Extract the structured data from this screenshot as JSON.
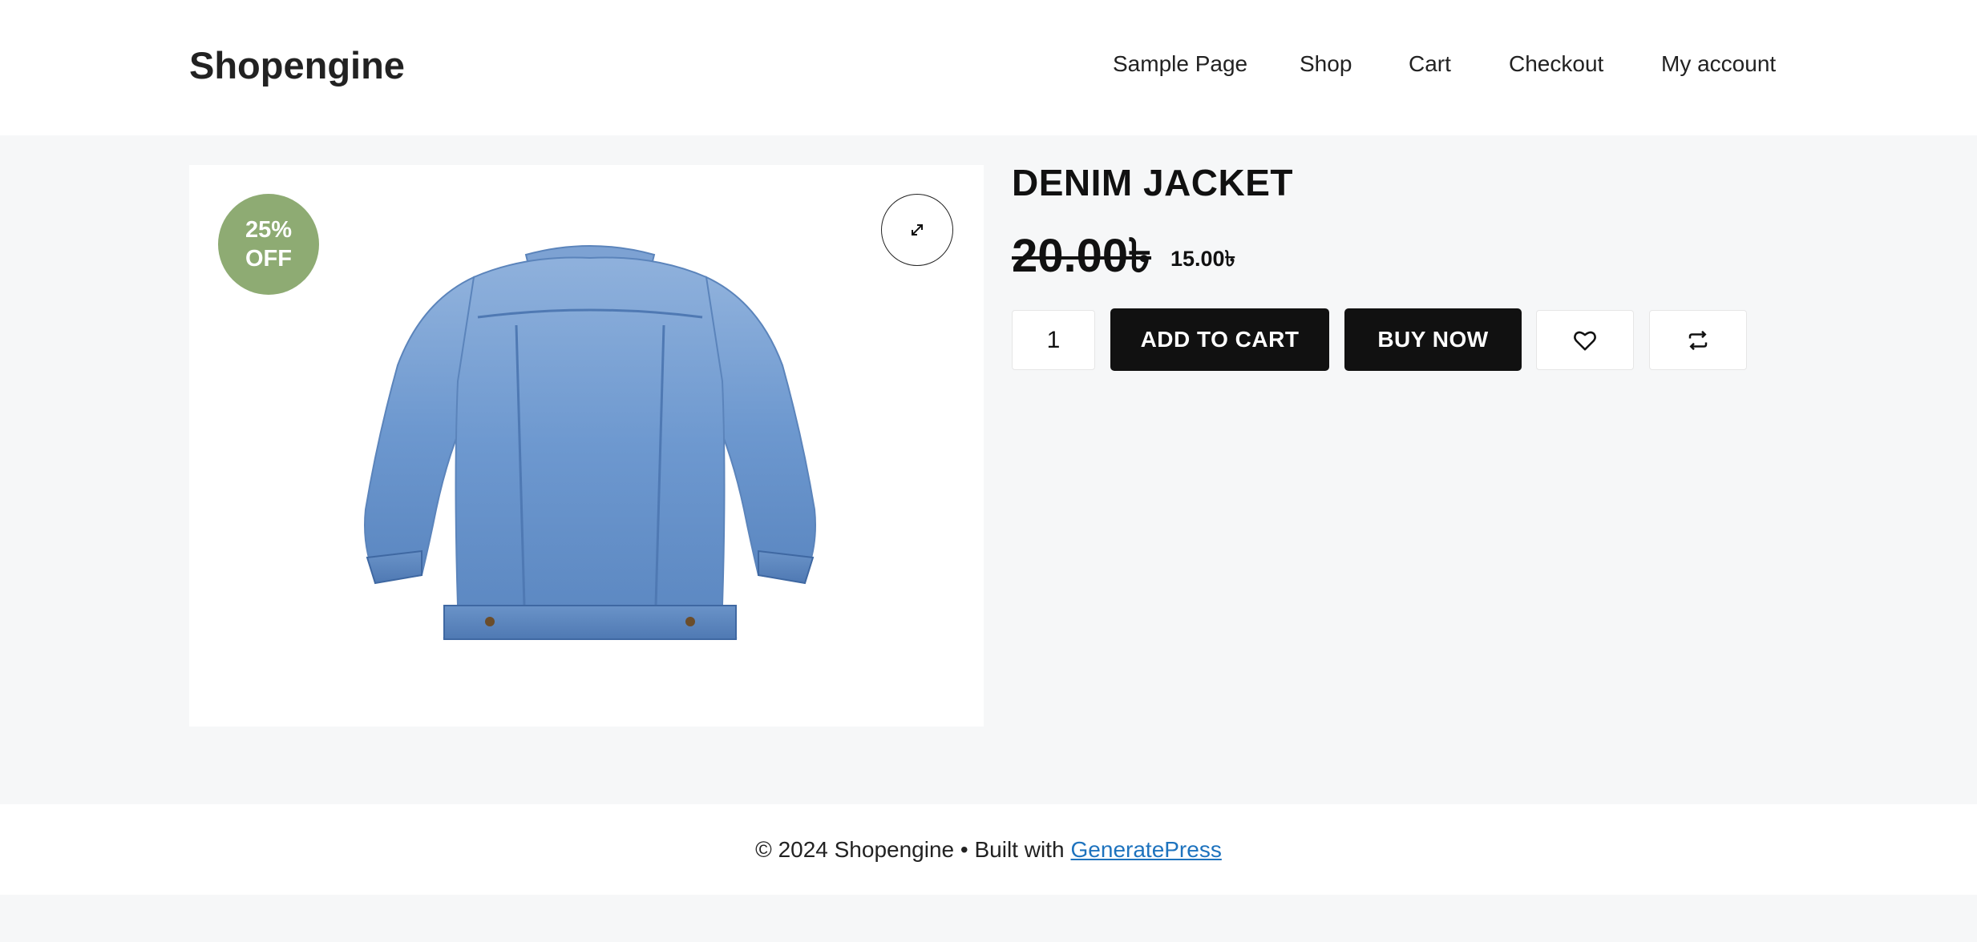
{
  "header": {
    "site_title": "Shopengine",
    "nav": [
      "Sample Page",
      "Shop",
      "Cart",
      "Checkout",
      "My account"
    ]
  },
  "product": {
    "badge_line1": "25%",
    "badge_line2": "OFF",
    "title": "DENIM JACKET",
    "price_old": "20.00৳",
    "price_new": "15.00৳",
    "quantity": "1",
    "add_to_cart_label": "ADD TO CART",
    "buy_now_label": "BUY NOW",
    "icons": {
      "zoom": "expand-icon",
      "wishlist": "heart-icon",
      "compare": "compare-arrows-icon"
    },
    "image_alt": "Denim jacket back view"
  },
  "footer": {
    "copyright": "© 2024 Shopengine • Built with",
    "link_label": "GeneratePress"
  },
  "colors": {
    "badge": "#8eab73",
    "button_dark": "#111111",
    "link": "#1e73be",
    "page_bg": "#f6f7f8"
  }
}
